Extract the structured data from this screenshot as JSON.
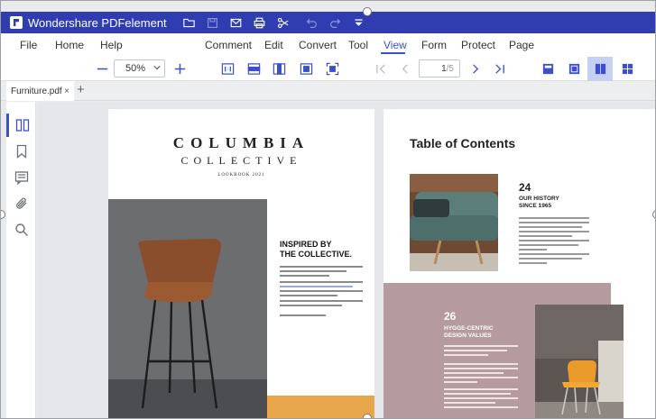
{
  "title_bar": {
    "app_title": "Wondershare PDFelement",
    "icons": [
      "folder-icon",
      "save-icon",
      "mail-icon",
      "print-icon",
      "scissors-icon",
      "undo-icon",
      "redo-icon",
      "quick-access-icon"
    ]
  },
  "menu": {
    "items": [
      "File",
      "Home",
      "Help",
      "Comment",
      "Edit",
      "Convert",
      "Tool",
      "View",
      "Form",
      "Protect",
      "Page"
    ],
    "active": "View"
  },
  "toolbar": {
    "zoom_value": "50%",
    "page_current": "1",
    "page_total": "/5"
  },
  "tab": {
    "file_name": "Furniture.pdf",
    "close_glyph": "×",
    "add_glyph": "+"
  },
  "doc": {
    "page1": {
      "brand_main": "COLUMBIA",
      "brand_sub": "COLLECTIVE",
      "lookbook": "LOOKBOOK 2021",
      "heading_line1": "INSPIRED BY",
      "heading_line2": "THE COLLECTIVE."
    },
    "page2": {
      "toc_title": "Table of Contents",
      "section1_number": "24",
      "section1_line1": "OUR HISTORY",
      "section1_line2": "SINCE 1965",
      "section2_number": "26",
      "section2_line1": "HYGGE-CENTRIC",
      "section2_line2": "DESIGN VALUES"
    }
  },
  "colors": {
    "accent": "#3c4fd1",
    "title_bar": "#2f3db1",
    "orange": "#e8a64a",
    "mauve": "#b59aa0"
  }
}
